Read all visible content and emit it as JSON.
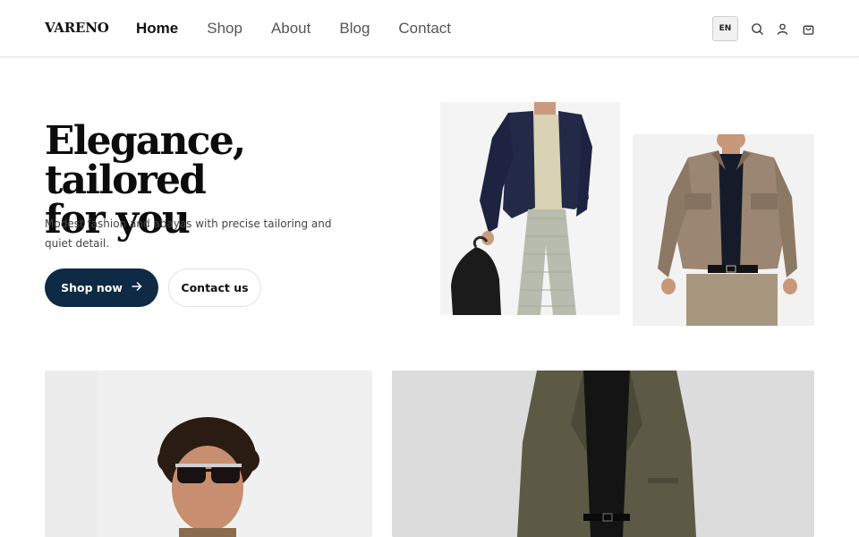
{
  "brand": {
    "logo": "VARENO"
  },
  "nav": {
    "items": [
      {
        "label": "Home",
        "active": true
      },
      {
        "label": "Shop"
      },
      {
        "label": "About"
      },
      {
        "label": "Blog"
      },
      {
        "label": "Contact"
      }
    ]
  },
  "header_actions": {
    "language": "EN",
    "icons": [
      "search-icon",
      "user-icon",
      "shopping-bag-icon"
    ]
  },
  "hero": {
    "title_line1": "Elegance, tailored",
    "title_line2": "for you",
    "subtitle": "Modest fashion and abayas with precise tailoring and quiet detail.",
    "primary_cta": "Shop now",
    "primary_cta_icon": "arrow-right-icon",
    "secondary_cta": "Contact us"
  },
  "colors": {
    "primary_button": "#0e2a44",
    "text": "#111111",
    "muted_text": "#444444"
  }
}
